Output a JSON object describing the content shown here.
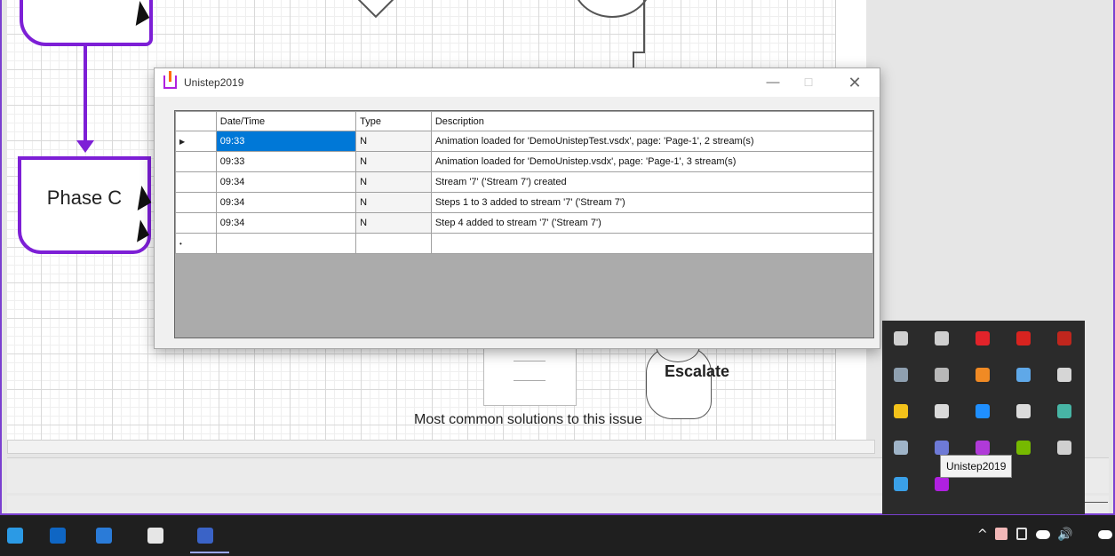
{
  "canvas": {
    "phase_label": "Phase C",
    "escalate_label": "Escalate",
    "solutions_text": "Most common solutions to this issue"
  },
  "dialog": {
    "title": "Unistep2019",
    "minimize_glyph": "—",
    "maximize_glyph": "☐",
    "close_glyph": "✕",
    "columns": [
      "Date/Time",
      "Type",
      "Description"
    ],
    "current_row_marker": "▶",
    "new_row_marker": "•",
    "rows": [
      {
        "time": "09:33",
        "type": "N",
        "description": "Animation loaded for 'DemoUnistepTest.vsdx', page: 'Page-1', 2 stream(s)"
      },
      {
        "time": "09:33",
        "type": "N",
        "description": "Animation loaded for 'DemoUnistep.vsdx', page: 'Page-1', 3 stream(s)"
      },
      {
        "time": "09:34",
        "type": "N",
        "description": "Stream  '7' ('Stream 7')  created"
      },
      {
        "time": "09:34",
        "type": "N",
        "description": "Steps 1 to 3 added to stream  '7' ('Stream 7')"
      },
      {
        "time": "09:34",
        "type": "N",
        "description": "Step 4 added to stream  '7' ('Stream 7')"
      }
    ]
  },
  "tray": {
    "tooltip": "Unistep2019",
    "icons": [
      {
        "name": "usb-drive-icon",
        "color": "#d0d0d0"
      },
      {
        "name": "satellite-icon",
        "color": "#cfcfcf"
      },
      {
        "name": "acrobat-icon",
        "color": "#e2232a"
      },
      {
        "name": "security-shield-icon",
        "color": "#d8231f"
      },
      {
        "name": "terminal-icon",
        "color": "#c0261d"
      },
      {
        "name": "hard-drive-icon",
        "color": "#8fa0b0"
      },
      {
        "name": "stylus-icon",
        "color": "#b8b8b8"
      },
      {
        "name": "sync-app-icon",
        "color": "#f08a24"
      },
      {
        "name": "steam-icon",
        "color": "#5fa8e8"
      },
      {
        "name": "network-icon",
        "color": "#d6d6d6"
      },
      {
        "name": "defender-shield-icon",
        "color": "#f3c21a"
      },
      {
        "name": "epic-games-icon",
        "color": "#dadada"
      },
      {
        "name": "bluetooth-icon",
        "color": "#1f8fff"
      },
      {
        "name": "target-icon",
        "color": "#dcdcdc"
      },
      {
        "name": "display-tool-icon",
        "color": "#47b5a5"
      },
      {
        "name": "crane-icon",
        "color": "#9fb4c8"
      },
      {
        "name": "magnet-icon",
        "color": "#6e7ad6"
      },
      {
        "name": "ring-icon",
        "color": "#b03ad8"
      },
      {
        "name": "nvidia-icon",
        "color": "#76b900"
      },
      {
        "name": "ethernet-icon",
        "color": "#d0d0d0"
      },
      {
        "name": "onedrive-icon",
        "color": "#3aa0e8"
      },
      {
        "name": "unistep-icon",
        "color": "#b020e0"
      }
    ]
  },
  "taskbar": {
    "icons": [
      {
        "name": "edge-icon",
        "color": "#2b9ae5"
      },
      {
        "name": "outlook-icon",
        "color": "#0f66c4"
      },
      {
        "name": "pdf-icon",
        "color": "#2a7bd8"
      },
      {
        "name": "snipping-tool-icon",
        "color": "#e6e6e6"
      },
      {
        "name": "visio-icon",
        "color": "#3a63c7"
      }
    ],
    "system": {
      "chevron": "^",
      "speaker": "🔊"
    }
  }
}
